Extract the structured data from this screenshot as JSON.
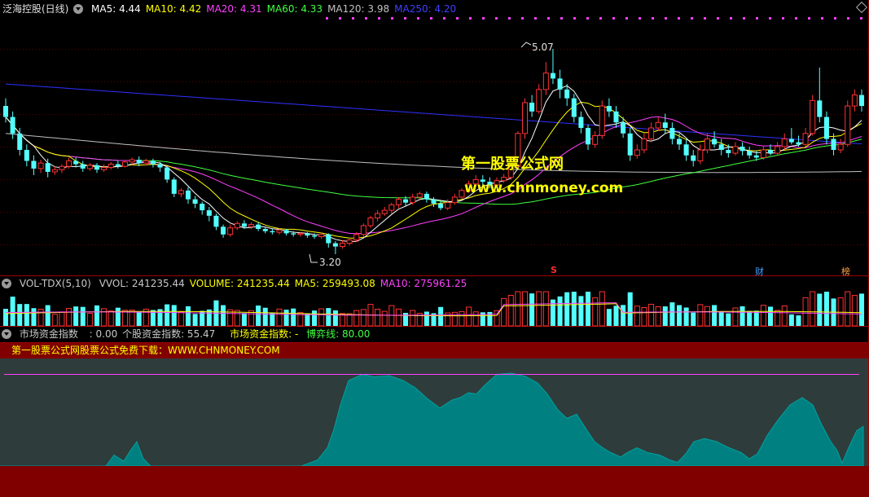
{
  "header": {
    "stock_title": "泛海控股(日线)",
    "ma_labels": [
      {
        "text": "MA5: 4.44",
        "color": "#ffffff"
      },
      {
        "text": "MA10: 4.42",
        "color": "#ffff00"
      },
      {
        "text": "MA20: 4.31",
        "color": "#ff40ff"
      },
      {
        "text": "MA60: 4.33",
        "color": "#40ff40"
      },
      {
        "text": "MA120: 3.98",
        "color": "#c0c0c0"
      },
      {
        "text": "MA250: 4.20",
        "color": "#4040ff"
      }
    ]
  },
  "price_chart": {
    "high_label": "5.07",
    "low_label": "3.20",
    "event_markers": [
      {
        "text": "S",
        "color": "#ff3030"
      },
      {
        "text": "财",
        "color": "#40a0ff"
      },
      {
        "text": "榜",
        "color": "#ffa040"
      }
    ]
  },
  "watermark": {
    "line1": "第一股票公式网",
    "line2": "www.chnmoney.com"
  },
  "volume_header": {
    "name": "VOL-TDX(5,10)",
    "labels": [
      {
        "text": "VVOL: 241235.44",
        "color": "#c8c8c8"
      },
      {
        "text": "VOLUME: 241235.44",
        "color": "#ffff00"
      },
      {
        "text": "MA5: 259493.08",
        "color": "#ffff00"
      },
      {
        "text": "MA10: 275961.25",
        "color": "#ff40ff"
      }
    ]
  },
  "fund_header": {
    "name": "市场资金指数",
    "value": ": 0.00",
    "stock_fund": "个股资金指数: 55.47",
    "market_fund": "市场资金指数: -",
    "game_line": "博弈线: 80.00"
  },
  "banner": {
    "text": "第一股票公式网股票公式免费下载：WWW.CHNMONEY.COM"
  },
  "chart_data": [
    {
      "type": "candlestick",
      "title": "泛海控股(日线)",
      "y_range": [
        3.2,
        5.07
      ],
      "high": 5.07,
      "low": 3.2,
      "candles": [
        [
          4.55,
          4.45,
          4.62,
          4.4
        ],
        [
          4.45,
          4.3,
          4.5,
          4.25
        ],
        [
          4.3,
          4.15,
          4.35,
          4.1
        ],
        [
          4.15,
          4.05,
          4.2,
          4.0
        ],
        [
          4.05,
          3.98,
          4.1,
          3.92
        ],
        [
          3.98,
          4.03,
          4.06,
          3.94
        ],
        [
          4.03,
          3.95,
          4.07,
          3.9
        ],
        [
          3.95,
          3.97,
          4.0,
          3.92
        ],
        [
          3.97,
          4.0,
          4.02,
          3.94
        ],
        [
          4.0,
          4.05,
          4.08,
          3.98
        ],
        [
          4.05,
          4.02,
          4.08,
          3.99
        ],
        [
          4.02,
          3.98,
          4.05,
          3.95
        ],
        [
          3.98,
          4.01,
          4.03,
          3.96
        ],
        [
          4.01,
          3.97,
          4.03,
          3.94
        ],
        [
          3.97,
          3.99,
          4.02,
          3.95
        ],
        [
          3.99,
          4.02,
          4.04,
          3.97
        ],
        [
          4.02,
          4.0,
          4.05,
          3.98
        ],
        [
          4.0,
          4.04,
          4.06,
          3.99
        ],
        [
          4.04,
          4.06,
          4.08,
          4.01
        ],
        [
          4.06,
          4.03,
          4.09,
          4.0
        ],
        [
          4.03,
          4.05,
          4.07,
          4.01
        ],
        [
          4.05,
          4.02,
          4.07,
          3.99
        ],
        [
          4.02,
          3.99,
          4.04,
          3.95
        ],
        [
          3.99,
          3.88,
          4.0,
          3.85
        ],
        [
          3.88,
          3.75,
          3.9,
          3.72
        ],
        [
          3.75,
          3.78,
          3.8,
          3.72
        ],
        [
          3.78,
          3.7,
          3.81,
          3.66
        ],
        [
          3.7,
          3.66,
          3.73,
          3.62
        ],
        [
          3.66,
          3.6,
          3.68,
          3.56
        ],
        [
          3.6,
          3.55,
          3.63,
          3.5
        ],
        [
          3.55,
          3.45,
          3.57,
          3.42
        ],
        [
          3.45,
          3.38,
          3.47,
          3.35
        ],
        [
          3.38,
          3.44,
          3.47,
          3.36
        ],
        [
          3.44,
          3.48,
          3.5,
          3.42
        ],
        [
          3.48,
          3.45,
          3.51,
          3.43
        ],
        [
          3.45,
          3.47,
          3.49,
          3.43
        ],
        [
          3.47,
          3.43,
          3.49,
          3.41
        ],
        [
          3.43,
          3.41,
          3.45,
          3.39
        ],
        [
          3.41,
          3.4,
          3.43,
          3.38
        ],
        [
          3.4,
          3.42,
          3.44,
          3.38
        ],
        [
          3.42,
          3.39,
          3.43,
          3.37
        ],
        [
          3.39,
          3.38,
          3.41,
          3.36
        ],
        [
          3.38,
          3.39,
          3.4,
          3.36
        ],
        [
          3.39,
          3.37,
          3.4,
          3.35
        ],
        [
          3.37,
          3.36,
          3.39,
          3.34
        ],
        [
          3.36,
          3.38,
          3.4,
          3.34
        ],
        [
          3.38,
          3.3,
          3.39,
          3.26
        ],
        [
          3.3,
          3.27,
          3.32,
          3.2
        ],
        [
          3.27,
          3.3,
          3.33,
          3.25
        ],
        [
          3.3,
          3.33,
          3.35,
          3.28
        ],
        [
          3.33,
          3.38,
          3.4,
          3.31
        ],
        [
          3.38,
          3.46,
          3.48,
          3.36
        ],
        [
          3.46,
          3.53,
          3.55,
          3.44
        ],
        [
          3.53,
          3.57,
          3.6,
          3.5
        ],
        [
          3.57,
          3.6,
          3.63,
          3.55
        ],
        [
          3.6,
          3.65,
          3.67,
          3.57
        ],
        [
          3.65,
          3.7,
          3.72,
          3.62
        ],
        [
          3.7,
          3.67,
          3.73,
          3.64
        ],
        [
          3.67,
          3.72,
          3.75,
          3.65
        ],
        [
          3.72,
          3.75,
          3.77,
          3.7
        ],
        [
          3.75,
          3.7,
          3.77,
          3.67
        ],
        [
          3.7,
          3.66,
          3.72,
          3.63
        ],
        [
          3.66,
          3.62,
          3.68,
          3.6
        ],
        [
          3.62,
          3.67,
          3.7,
          3.6
        ],
        [
          3.67,
          3.72,
          3.75,
          3.65
        ],
        [
          3.72,
          3.78,
          3.8,
          3.7
        ],
        [
          3.78,
          3.84,
          3.87,
          3.76
        ],
        [
          3.84,
          3.88,
          3.92,
          3.82
        ],
        [
          3.88,
          3.86,
          3.92,
          3.83
        ],
        [
          3.86,
          3.83,
          3.9,
          3.8
        ],
        [
          3.83,
          3.87,
          3.9,
          3.81
        ],
        [
          3.87,
          3.9,
          3.93,
          3.85
        ],
        [
          3.9,
          4.0,
          4.02,
          3.88
        ],
        [
          4.0,
          4.3,
          4.32,
          3.98
        ],
        [
          4.3,
          4.58,
          4.62,
          4.25
        ],
        [
          4.58,
          4.5,
          4.65,
          4.45
        ],
        [
          4.5,
          4.7,
          4.75,
          4.48
        ],
        [
          4.7,
          4.85,
          4.95,
          4.65
        ],
        [
          4.85,
          4.8,
          5.07,
          4.75
        ],
        [
          4.8,
          4.7,
          4.88,
          4.62
        ],
        [
          4.7,
          4.62,
          4.75,
          4.55
        ],
        [
          4.62,
          4.45,
          4.66,
          4.4
        ],
        [
          4.45,
          4.35,
          4.5,
          4.3
        ],
        [
          4.35,
          4.2,
          4.38,
          4.15
        ],
        [
          4.2,
          4.28,
          4.32,
          4.17
        ],
        [
          4.28,
          4.55,
          4.6,
          4.25
        ],
        [
          4.55,
          4.5,
          4.62,
          4.45
        ],
        [
          4.5,
          4.4,
          4.55,
          4.35
        ],
        [
          4.4,
          4.3,
          4.45,
          4.26
        ],
        [
          4.3,
          4.1,
          4.35,
          4.05
        ],
        [
          4.1,
          4.15,
          4.2,
          4.07
        ],
        [
          4.15,
          4.25,
          4.3,
          4.12
        ],
        [
          4.25,
          4.35,
          4.4,
          4.22
        ],
        [
          4.35,
          4.4,
          4.45,
          4.32
        ],
        [
          4.4,
          4.35,
          4.48,
          4.3
        ],
        [
          4.35,
          4.25,
          4.4,
          4.2
        ],
        [
          4.25,
          4.2,
          4.3,
          4.15
        ],
        [
          4.2,
          4.1,
          4.25,
          4.05
        ],
        [
          4.1,
          4.05,
          4.15,
          4.0
        ],
        [
          4.05,
          4.15,
          4.2,
          4.02
        ],
        [
          4.15,
          4.25,
          4.3,
          4.12
        ],
        [
          4.25,
          4.2,
          4.32,
          4.17
        ],
        [
          4.2,
          4.15,
          4.25,
          4.1
        ],
        [
          4.15,
          4.12,
          4.2,
          4.08
        ],
        [
          4.12,
          4.18,
          4.22,
          4.1
        ],
        [
          4.18,
          4.14,
          4.22,
          4.1
        ],
        [
          4.14,
          4.1,
          4.18,
          4.07
        ],
        [
          4.1,
          4.08,
          4.14,
          4.05
        ],
        [
          4.08,
          4.15,
          4.18,
          4.06
        ],
        [
          4.15,
          4.12,
          4.2,
          4.1
        ],
        [
          4.12,
          4.18,
          4.22,
          4.1
        ],
        [
          4.18,
          4.25,
          4.3,
          4.15
        ],
        [
          4.25,
          4.22,
          4.35,
          4.2
        ],
        [
          4.22,
          4.2,
          4.28,
          4.18
        ],
        [
          4.2,
          4.3,
          4.35,
          4.18
        ],
        [
          4.3,
          4.6,
          4.65,
          4.28
        ],
        [
          4.6,
          4.45,
          4.9,
          4.4
        ],
        [
          4.45,
          4.25,
          4.5,
          4.2
        ],
        [
          4.25,
          4.15,
          4.3,
          4.1
        ],
        [
          4.15,
          4.2,
          4.25,
          4.12
        ],
        [
          4.2,
          4.55,
          4.6,
          4.18
        ],
        [
          4.55,
          4.65,
          4.7,
          4.5
        ],
        [
          4.65,
          4.55,
          4.7,
          4.5
        ]
      ],
      "moving_averages": {
        "MA5": 4.44,
        "MA10": 4.42,
        "MA20": 4.31,
        "MA60": 4.33,
        "MA120": 3.98,
        "MA250": 4.2
      }
    },
    {
      "type": "bar",
      "title": "VOL-TDX(5,10)",
      "series": [
        {
          "name": "VVOL",
          "values": [
            241235.44
          ]
        },
        {
          "name": "MA5",
          "values": [
            259493.08
          ]
        },
        {
          "name": "MA10",
          "values": [
            275961.25
          ]
        }
      ]
    },
    {
      "type": "area",
      "title": "市场资金指数",
      "series": [
        {
          "name": "个股资金指数",
          "values": [
            55.47
          ]
        },
        {
          "name": "博弈线",
          "values": [
            80.0
          ]
        }
      ]
    }
  ]
}
